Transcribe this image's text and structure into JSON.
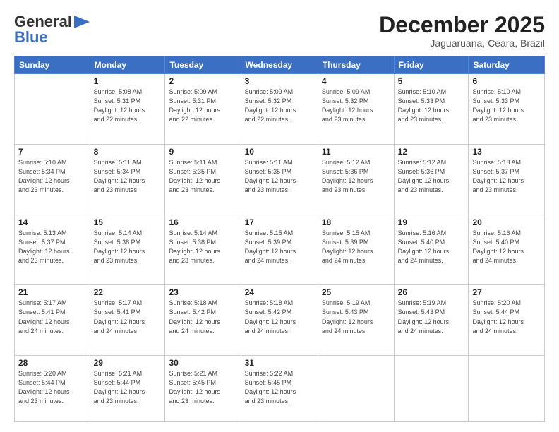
{
  "logo": {
    "general": "General",
    "blue": "Blue"
  },
  "header": {
    "month": "December 2025",
    "location": "Jaguaruana, Ceara, Brazil"
  },
  "weekdays": [
    "Sunday",
    "Monday",
    "Tuesday",
    "Wednesday",
    "Thursday",
    "Friday",
    "Saturday"
  ],
  "weeks": [
    [
      {
        "day": "",
        "info": ""
      },
      {
        "day": "1",
        "info": "Sunrise: 5:08 AM\nSunset: 5:31 PM\nDaylight: 12 hours\nand 22 minutes."
      },
      {
        "day": "2",
        "info": "Sunrise: 5:09 AM\nSunset: 5:31 PM\nDaylight: 12 hours\nand 22 minutes."
      },
      {
        "day": "3",
        "info": "Sunrise: 5:09 AM\nSunset: 5:32 PM\nDaylight: 12 hours\nand 22 minutes."
      },
      {
        "day": "4",
        "info": "Sunrise: 5:09 AM\nSunset: 5:32 PM\nDaylight: 12 hours\nand 23 minutes."
      },
      {
        "day": "5",
        "info": "Sunrise: 5:10 AM\nSunset: 5:33 PM\nDaylight: 12 hours\nand 23 minutes."
      },
      {
        "day": "6",
        "info": "Sunrise: 5:10 AM\nSunset: 5:33 PM\nDaylight: 12 hours\nand 23 minutes."
      }
    ],
    [
      {
        "day": "7",
        "info": "Sunrise: 5:10 AM\nSunset: 5:34 PM\nDaylight: 12 hours\nand 23 minutes."
      },
      {
        "day": "8",
        "info": "Sunrise: 5:11 AM\nSunset: 5:34 PM\nDaylight: 12 hours\nand 23 minutes."
      },
      {
        "day": "9",
        "info": "Sunrise: 5:11 AM\nSunset: 5:35 PM\nDaylight: 12 hours\nand 23 minutes."
      },
      {
        "day": "10",
        "info": "Sunrise: 5:11 AM\nSunset: 5:35 PM\nDaylight: 12 hours\nand 23 minutes."
      },
      {
        "day": "11",
        "info": "Sunrise: 5:12 AM\nSunset: 5:36 PM\nDaylight: 12 hours\nand 23 minutes."
      },
      {
        "day": "12",
        "info": "Sunrise: 5:12 AM\nSunset: 5:36 PM\nDaylight: 12 hours\nand 23 minutes."
      },
      {
        "day": "13",
        "info": "Sunrise: 5:13 AM\nSunset: 5:37 PM\nDaylight: 12 hours\nand 23 minutes."
      }
    ],
    [
      {
        "day": "14",
        "info": "Sunrise: 5:13 AM\nSunset: 5:37 PM\nDaylight: 12 hours\nand 23 minutes."
      },
      {
        "day": "15",
        "info": "Sunrise: 5:14 AM\nSunset: 5:38 PM\nDaylight: 12 hours\nand 23 minutes."
      },
      {
        "day": "16",
        "info": "Sunrise: 5:14 AM\nSunset: 5:38 PM\nDaylight: 12 hours\nand 23 minutes."
      },
      {
        "day": "17",
        "info": "Sunrise: 5:15 AM\nSunset: 5:39 PM\nDaylight: 12 hours\nand 24 minutes."
      },
      {
        "day": "18",
        "info": "Sunrise: 5:15 AM\nSunset: 5:39 PM\nDaylight: 12 hours\nand 24 minutes."
      },
      {
        "day": "19",
        "info": "Sunrise: 5:16 AM\nSunset: 5:40 PM\nDaylight: 12 hours\nand 24 minutes."
      },
      {
        "day": "20",
        "info": "Sunrise: 5:16 AM\nSunset: 5:40 PM\nDaylight: 12 hours\nand 24 minutes."
      }
    ],
    [
      {
        "day": "21",
        "info": "Sunrise: 5:17 AM\nSunset: 5:41 PM\nDaylight: 12 hours\nand 24 minutes."
      },
      {
        "day": "22",
        "info": "Sunrise: 5:17 AM\nSunset: 5:41 PM\nDaylight: 12 hours\nand 24 minutes."
      },
      {
        "day": "23",
        "info": "Sunrise: 5:18 AM\nSunset: 5:42 PM\nDaylight: 12 hours\nand 24 minutes."
      },
      {
        "day": "24",
        "info": "Sunrise: 5:18 AM\nSunset: 5:42 PM\nDaylight: 12 hours\nand 24 minutes."
      },
      {
        "day": "25",
        "info": "Sunrise: 5:19 AM\nSunset: 5:43 PM\nDaylight: 12 hours\nand 24 minutes."
      },
      {
        "day": "26",
        "info": "Sunrise: 5:19 AM\nSunset: 5:43 PM\nDaylight: 12 hours\nand 24 minutes."
      },
      {
        "day": "27",
        "info": "Sunrise: 5:20 AM\nSunset: 5:44 PM\nDaylight: 12 hours\nand 24 minutes."
      }
    ],
    [
      {
        "day": "28",
        "info": "Sunrise: 5:20 AM\nSunset: 5:44 PM\nDaylight: 12 hours\nand 23 minutes."
      },
      {
        "day": "29",
        "info": "Sunrise: 5:21 AM\nSunset: 5:44 PM\nDaylight: 12 hours\nand 23 minutes."
      },
      {
        "day": "30",
        "info": "Sunrise: 5:21 AM\nSunset: 5:45 PM\nDaylight: 12 hours\nand 23 minutes."
      },
      {
        "day": "31",
        "info": "Sunrise: 5:22 AM\nSunset: 5:45 PM\nDaylight: 12 hours\nand 23 minutes."
      },
      {
        "day": "",
        "info": ""
      },
      {
        "day": "",
        "info": ""
      },
      {
        "day": "",
        "info": ""
      }
    ]
  ]
}
